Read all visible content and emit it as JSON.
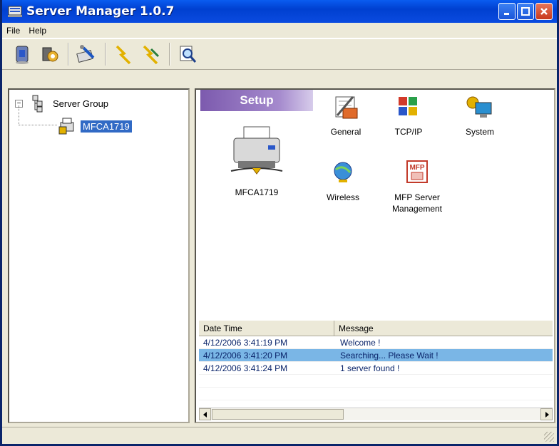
{
  "window": {
    "title": "Server Manager 1.0.7"
  },
  "title_buttons": [
    "minimize",
    "maximize",
    "close"
  ],
  "menu": [
    {
      "label": "File"
    },
    {
      "label": "Help"
    }
  ],
  "toolbar": {
    "tools": [
      {
        "icon": "server-icon"
      },
      {
        "icon": "server-settings-icon"
      },
      {
        "icon": "configure-icon"
      },
      {
        "icon": "connect-icon"
      },
      {
        "icon": "disconnect-icon"
      },
      {
        "icon": "search-icon"
      }
    ]
  },
  "tree": {
    "root_label": "Server Group",
    "child_label": "MFCA1719"
  },
  "setup": {
    "banner": "Setup",
    "device_label": "MFCA1719",
    "items": [
      {
        "label": "General",
        "icon": "general-icon"
      },
      {
        "label": "TCP/IP",
        "icon": "tcpip-icon"
      },
      {
        "label": "System",
        "icon": "system-icon"
      },
      {
        "label": "Wireless",
        "icon": "wireless-icon"
      },
      {
        "label": "MFP Server Management",
        "icon": "mfp-icon"
      }
    ]
  },
  "log": {
    "columns": [
      "Date Time",
      "Message"
    ],
    "rows": [
      {
        "time": "4/12/2006 3:41:19 PM",
        "message": "Welcome !"
      },
      {
        "time": "4/12/2006 3:41:20 PM",
        "message": "Searching... Please Wait !"
      },
      {
        "time": "4/12/2006 3:41:24 PM",
        "message": "1 server found !"
      }
    ],
    "selected_row": 1
  }
}
